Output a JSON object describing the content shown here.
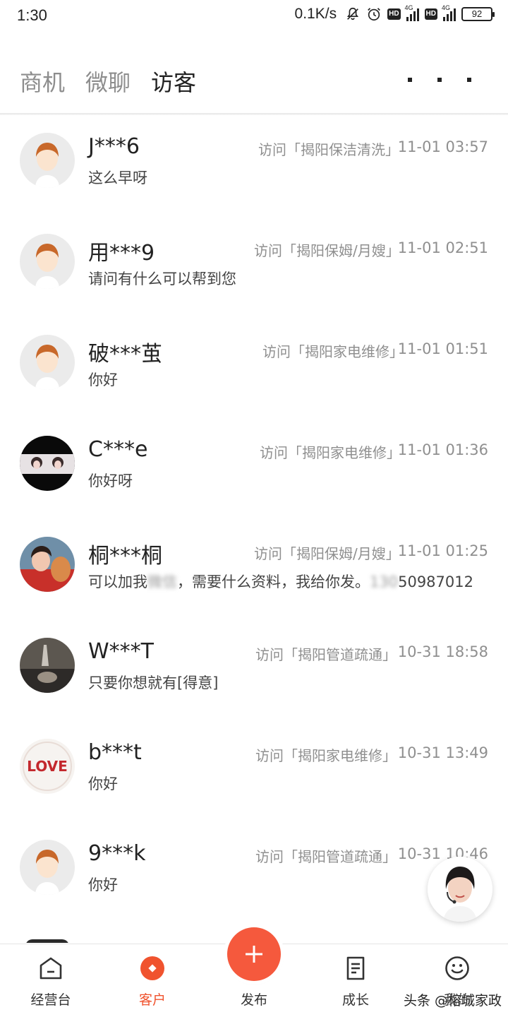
{
  "status_bar": {
    "time": "1:30",
    "net_speed": "0.1K/s",
    "hd_label": "HD",
    "signal_tag": "4G",
    "battery": "92"
  },
  "tabs": [
    {
      "label": "商机",
      "active": false
    },
    {
      "label": "微聊",
      "active": false
    },
    {
      "label": "访客",
      "active": true
    }
  ],
  "visitors": [
    {
      "name": "J***6",
      "visit": "访问「揭阳保洁清洗」",
      "time": "11-01 03:57",
      "message": "这么早呀",
      "avatar": "default-avatar"
    },
    {
      "name": "用***9",
      "visit": "访问「揭阳保姆/月嫂」",
      "time": "11-01 02:51",
      "message": "请问有什么可以帮到您",
      "avatar": "default-avatar"
    },
    {
      "name": "破***茧",
      "visit": "访问「揭阳家电维修」",
      "time": "11-01 01:51",
      "message": "你好",
      "avatar": "default-avatar"
    },
    {
      "name": "C***e",
      "visit": "访问「揭阳家电维修」",
      "time": "11-01 01:36",
      "message": "你好呀",
      "avatar": "photo-avatar"
    },
    {
      "name": "桐***桐",
      "visit": "访问「揭阳保姆/月嫂」",
      "time": "11-01 01:25",
      "message": "可以加我微信，需要什么资料，我给你发。13050987012",
      "avatar": "photo-avatar"
    },
    {
      "name": "W***T",
      "visit": "访问「揭阳管道疏通」",
      "time": "10-31 18:58",
      "message": "只要你想就有[得意]",
      "avatar": "photo-avatar"
    },
    {
      "name": "b***t",
      "visit": "访问「揭阳家电维修」",
      "time": "10-31 13:49",
      "message": "你好",
      "avatar": "love-avatar"
    },
    {
      "name": "9***k",
      "visit": "访问「揭阳管道疏通」",
      "time": "10-31 10:46",
      "message": "你好",
      "avatar": "default-avatar"
    }
  ],
  "message_parts": {
    "row4_prefix": "可以加我",
    "row4_blur1": "微信",
    "row4_mid": "，需要什么资料，我给你发。",
    "row4_blur2": "130",
    "row4_suffix": "50987012"
  },
  "bottom_nav": [
    {
      "label": "经营台",
      "icon": "home-icon",
      "active": false
    },
    {
      "label": "客户",
      "icon": "customer-icon",
      "active": true
    },
    {
      "label": "发布",
      "icon": "plus-icon",
      "active": false
    },
    {
      "label": "成长",
      "icon": "document-icon",
      "active": false
    },
    {
      "label": "我的",
      "icon": "smiley-icon",
      "active": false
    }
  ],
  "watermark": "头条 @榕城家政",
  "colors": {
    "accent": "#f5593d",
    "active_nav": "#f0532e",
    "muted_text": "#8f8f8f"
  }
}
